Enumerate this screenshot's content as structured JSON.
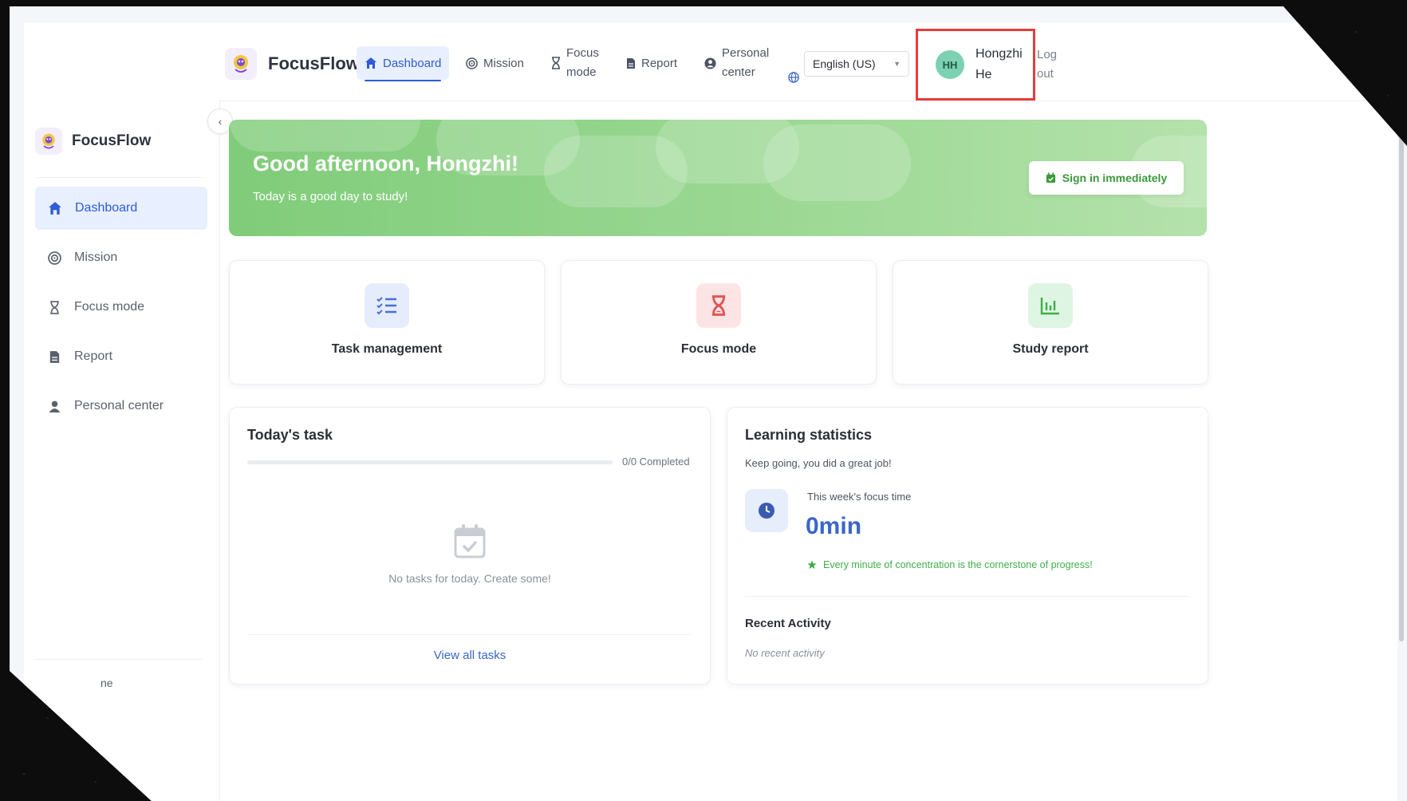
{
  "app": {
    "name": "FocusFlow"
  },
  "topnav": {
    "items": [
      {
        "label": "Dashboard",
        "icon": "home-icon",
        "active": true
      },
      {
        "label": "Mission",
        "icon": "target-icon"
      },
      {
        "label": "Focus mode",
        "icon": "hourglass-icon"
      },
      {
        "label": "Report",
        "icon": "document-icon"
      },
      {
        "label": "Personal center",
        "icon": "user-circle-icon"
      }
    ],
    "language": "English (US)",
    "user": {
      "initials": "HH",
      "name": "Hongzhi He"
    },
    "logout": "Log out"
  },
  "sidebar": {
    "items": [
      {
        "label": "Dashboard",
        "icon": "home-icon",
        "active": true
      },
      {
        "label": "Mission",
        "icon": "target-icon"
      },
      {
        "label": "Focus mode",
        "icon": "hourglass-icon"
      },
      {
        "label": "Report",
        "icon": "document-icon"
      },
      {
        "label": "Personal center",
        "icon": "user-icon"
      }
    ],
    "footer_text": "ne"
  },
  "banner": {
    "greeting": "Good afternoon, Hongzhi!",
    "subtitle": "Today is a good day to study!",
    "button": "Sign in immediately"
  },
  "quick_actions": [
    {
      "label": "Task management",
      "icon": "checklist-icon",
      "color": "#4a6fd8"
    },
    {
      "label": "Focus mode",
      "icon": "hourglass-icon",
      "color": "#e05555"
    },
    {
      "label": "Study report",
      "icon": "chart-icon",
      "color": "#3fae49"
    }
  ],
  "tasks": {
    "title": "Today's task",
    "progress_label": "0/0 Completed",
    "progress": 0,
    "empty": "No tasks for today. Create some!",
    "view_all": "View all tasks"
  },
  "stats": {
    "title": "Learning statistics",
    "subtitle": "Keep going, you did a great job!",
    "focus_label": "This week's focus time",
    "focus_value": "0min",
    "tip": "Every minute of concentration is the cornerstone of progress!",
    "recent_title": "Recent Activity",
    "recent_empty": "No recent activity"
  },
  "colors": {
    "accent": "#2e5bd6",
    "banner": "#8fd487",
    "highlight": "#e93b3b"
  }
}
